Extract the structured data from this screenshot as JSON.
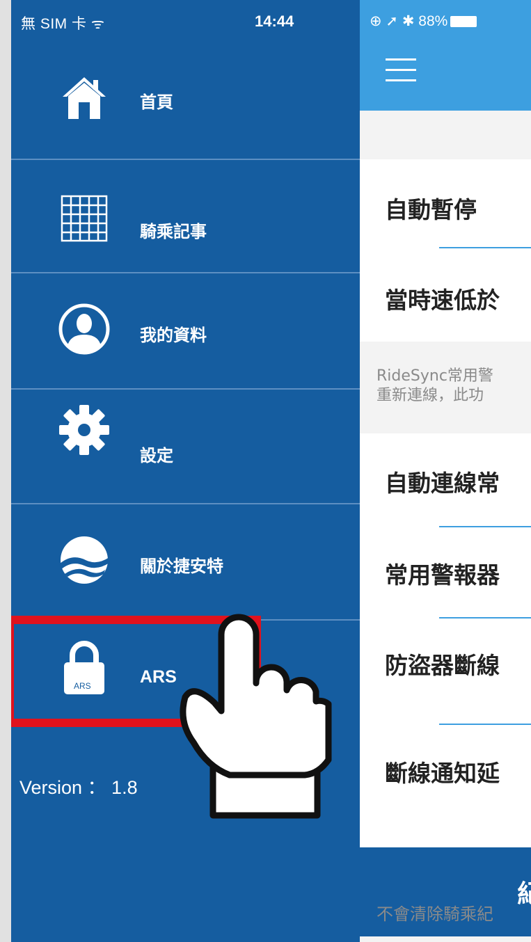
{
  "status_bar": {
    "carrier": "無 SIM 卡 ᯤ",
    "time": "14:44",
    "right_icons": "⊕ ➚ ✱ 88%"
  },
  "sidebar": {
    "items": [
      {
        "label": "首頁",
        "icon": "home-icon"
      },
      {
        "label": "騎乘記事",
        "icon": "calendar-grid-icon"
      },
      {
        "label": "我的資料",
        "icon": "profile-icon"
      },
      {
        "label": "設定",
        "icon": "gear-icon"
      },
      {
        "label": "關於捷安特",
        "icon": "brand-logo-icon"
      },
      {
        "label": "ARS",
        "icon": "lock-icon",
        "highlighted": true
      }
    ],
    "lock_badge": "ARS",
    "version": "Version ： 1.8"
  },
  "content": {
    "rows": [
      "自動暫停",
      "當時速低於",
      "自動連線常",
      "常用警報器",
      "防盜器斷線",
      "斷線通知延"
    ],
    "desc_lines": [
      "RideSync常用警",
      "重新連線，此功"
    ],
    "blue_band_text": "紀",
    "footer_text": "不會清除騎乘紀"
  },
  "colors": {
    "sidebar_bg": "#155da0",
    "topbar_bg": "#3d9fe0",
    "highlight": "#e0121d"
  }
}
